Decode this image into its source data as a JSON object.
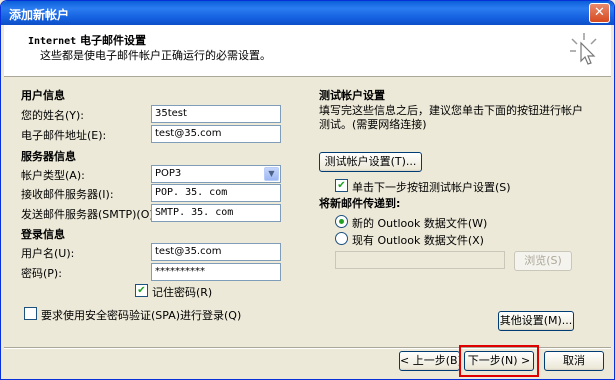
{
  "window": {
    "title": "添加新帐户",
    "close_icon": "close-icon"
  },
  "header": {
    "title_prefix": "Internet",
    "title_rest": " 电子邮件设置",
    "subtitle": "这些都是使电子邮件帐户正确运行的必需设置。"
  },
  "user_info": {
    "section": "用户信息",
    "name_label": "您的姓名(Y):",
    "name_value": "35test",
    "email_label": "电子邮件地址(E):",
    "email_value": "test@35.com"
  },
  "server_info": {
    "section": "服务器信息",
    "type_label": "帐户类型(A):",
    "type_value": "POP3",
    "incoming_label": "接收邮件服务器(I):",
    "incoming_value": "POP. 35. com",
    "outgoing_label": "发送邮件服务器(SMTP)(O):",
    "outgoing_value": "SMTP. 35. com"
  },
  "login_info": {
    "section": "登录信息",
    "username_label": "用户名(U):",
    "username_value": "test@35.com",
    "password_label": "密码(P):",
    "password_value": "**********",
    "remember_label": "记住密码(R)",
    "remember_checked": true,
    "spa_label": "要求使用安全密码验证(SPA)进行登录(Q)",
    "spa_checked": false
  },
  "test_settings": {
    "section": "测试帐户设置",
    "desc": "填写完这些信息之后，建议您单击下面的按钮进行帐户测试。(需要网络连接)",
    "test_button": "测试帐户设置(T)...",
    "auto_test_label": "单击下一步按钮测试帐户设置(S)",
    "auto_test_checked": true
  },
  "delivery": {
    "section": "将新邮件传递到:",
    "new_label": "新的 Outlook 数据文件(W)",
    "existing_label": "现有 Outlook 数据文件(X)",
    "selected": "new",
    "path_value": "",
    "browse_button": "浏览(S)"
  },
  "more_settings_button": "其他设置(M)...",
  "footer": {
    "back_button": "< 上一步(B)",
    "next_button": "下一步(N) >",
    "cancel_button": "取消"
  },
  "colors": {
    "title_bar": "#0a5fd8",
    "highlight": "#e00000",
    "check": "#21a121"
  }
}
